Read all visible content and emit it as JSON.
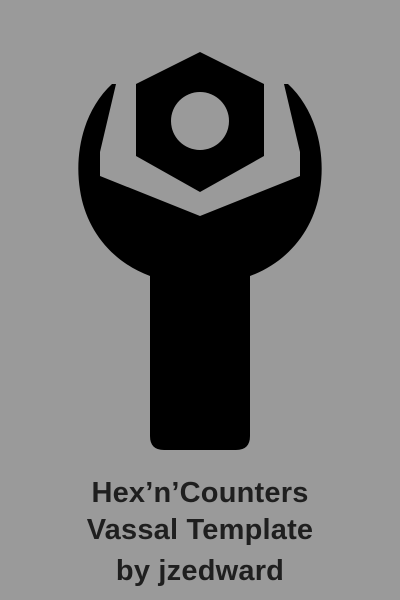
{
  "colors": {
    "background": "#9a9a9a",
    "icon": "#000000",
    "hole": "#9a9a9a",
    "text": "#1f1f1f"
  },
  "logo": {
    "icon": "wrench-and-hex-nut-icon"
  },
  "caption": {
    "line1": "Hex’n’Counters",
    "line2": "Vassal Template",
    "line3": "by jzedward"
  }
}
